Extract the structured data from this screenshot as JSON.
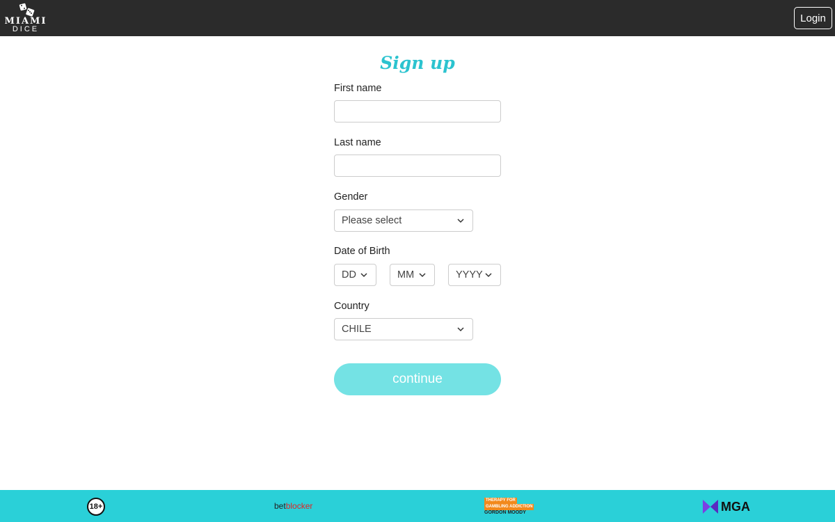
{
  "header": {
    "logo_word": "MIAMI",
    "logo_sub": "DICE",
    "login_label": "Login"
  },
  "form": {
    "title": "Sign up",
    "first_name_label": "First name",
    "last_name_label": "Last name",
    "gender_label": "Gender",
    "gender_value": "Please select",
    "dob_label": "Date of Birth",
    "dob_day": "DD",
    "dob_month": "MM",
    "dob_year": "YYYY",
    "country_label": "Country",
    "country_value": "CHILE",
    "continue_label": "continue"
  },
  "footer": {
    "age_badge": "18+",
    "betblocker_a": "bet",
    "betblocker_b": "blocker",
    "gordon_line1": "THERAPY FOR",
    "gordon_line2": "GAMBLING ADDICTION",
    "gordon_line3": "GORDON MOODY",
    "mga_label": "MGA"
  },
  "colors": {
    "topbar": "#2b2b2b",
    "accent": "#2bc3cf",
    "continue_button": "#74e2e4",
    "footer": "#2ad0d8"
  }
}
